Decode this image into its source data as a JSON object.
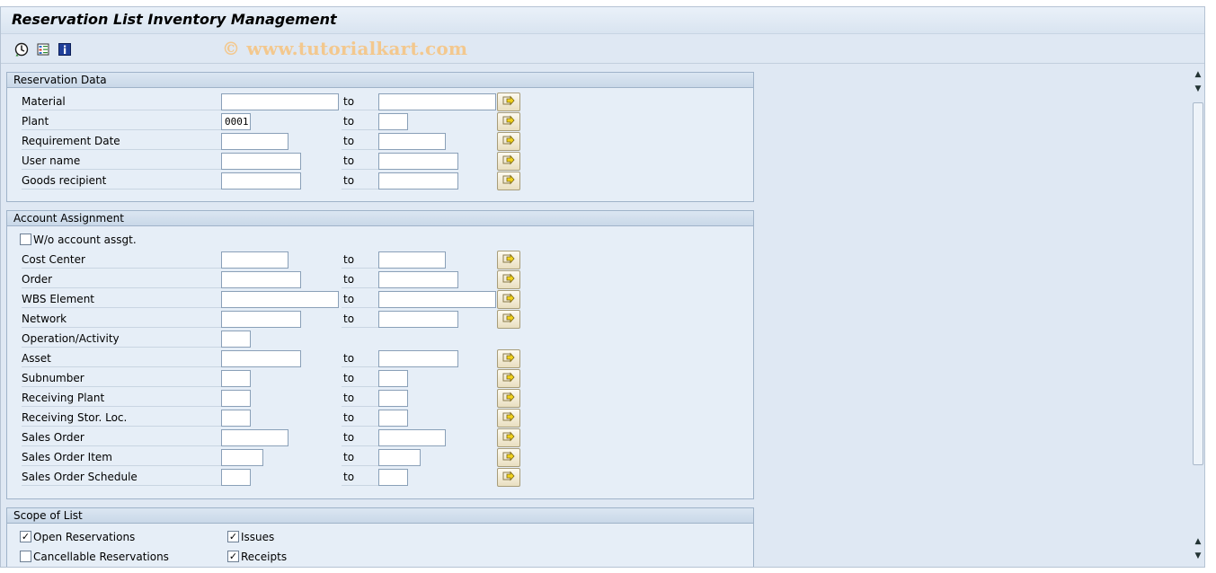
{
  "title": "Reservation List Inventory Management",
  "watermark": "© www.tutorialkart.com",
  "toolbar": {
    "icons": [
      "execute-icon",
      "selection-options-icon",
      "info-icon"
    ]
  },
  "to_label": "to",
  "groups": {
    "reservation": {
      "header": "Reservation Data",
      "rows": [
        {
          "label": "Material",
          "from": "",
          "to": ""
        },
        {
          "label": "Plant",
          "from": "0001",
          "to": ""
        },
        {
          "label": "Requirement Date",
          "from": "",
          "to": ""
        },
        {
          "label": "User name",
          "from": "",
          "to": ""
        },
        {
          "label": "Goods recipient",
          "from": "",
          "to": ""
        }
      ]
    },
    "account": {
      "header": "Account Assignment",
      "wo_label": "W/o account assgt.",
      "rows": [
        {
          "label": "Cost Center"
        },
        {
          "label": "Order"
        },
        {
          "label": "WBS Element"
        },
        {
          "label": "Network"
        },
        {
          "label": "Operation/Activity"
        },
        {
          "label": "Asset"
        },
        {
          "label": "Subnumber"
        },
        {
          "label": "Receiving Plant"
        },
        {
          "label": "Receiving Stor. Loc."
        },
        {
          "label": "Sales Order"
        },
        {
          "label": "Sales Order Item"
        },
        {
          "label": "Sales Order Schedule"
        }
      ]
    },
    "scope": {
      "header": "Scope of List",
      "options": [
        {
          "label": "Open Reservations",
          "checked": true
        },
        {
          "label": "Issues",
          "checked": true
        },
        {
          "label": "Cancellable Reservations",
          "checked": false
        },
        {
          "label": "Receipts",
          "checked": true
        }
      ]
    }
  }
}
